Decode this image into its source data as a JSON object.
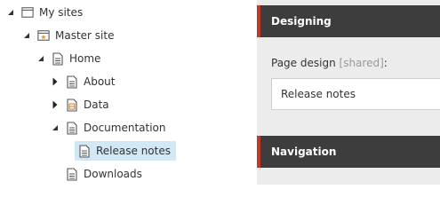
{
  "tree": {
    "nodes": [
      {
        "label": "My sites",
        "icon": "sites-icon",
        "expanded": true
      },
      {
        "label": "Master site",
        "icon": "master-site-icon",
        "expanded": true
      },
      {
        "label": "Home",
        "icon": "page-icon",
        "expanded": true
      },
      {
        "label": "About",
        "icon": "page-icon",
        "expanded": false
      },
      {
        "label": "Data",
        "icon": "data-page-icon",
        "expanded": false
      },
      {
        "label": "Documentation",
        "icon": "page-icon",
        "expanded": true
      },
      {
        "label": "Release notes",
        "icon": "page-icon",
        "selected": true
      },
      {
        "label": "Downloads",
        "icon": "page-icon"
      }
    ]
  },
  "designing": {
    "title": "Designing",
    "page_design_label": "Page design",
    "page_design_suffix": "[shared]",
    "page_design_colon": ":",
    "page_design_value": "Release notes"
  },
  "navigation": {
    "title": "Navigation"
  },
  "colors": {
    "panel_header": "#3d3d3d",
    "panel_accent": "#c0392b",
    "selection": "#d2e8f5",
    "right_background": "#ececec"
  }
}
